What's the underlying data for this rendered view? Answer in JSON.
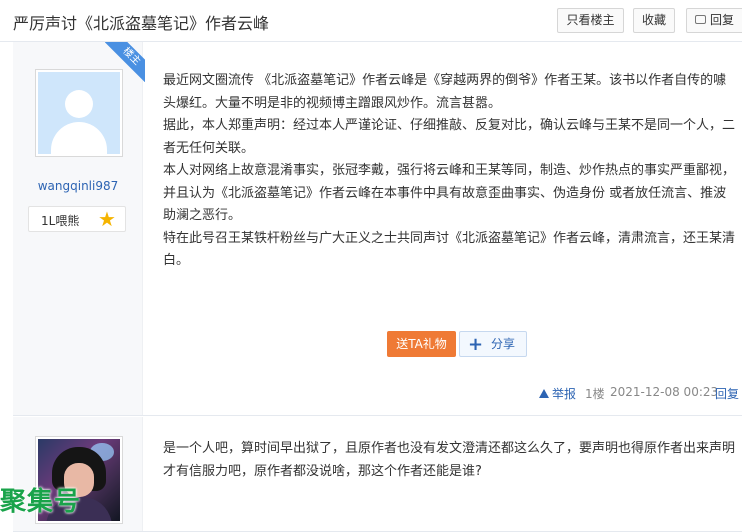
{
  "thread": {
    "title": "严厉声讨《北派盗墓笔记》作者云峰",
    "only_op_label": "只看楼主",
    "favorite_label": "收藏",
    "reply_label": "回复"
  },
  "posts": [
    {
      "username": "wangqinli987",
      "level_label": "1L喂熊",
      "op_badge": "楼主",
      "paragraphs": [
        "最近网文圈流传 《北派盗墓笔记》作者云峰是《穿越两界的倒爷》作者王某。该书以作者自传的噱头爆红。大量不明是非的视频博主蹭跟风炒作。流言甚嚣。",
        "据此，本人郑重声明：经过本人严谨论证、仔细推敲、反复对比，确认云峰与王某不是同一个人，二者无任何关联。",
        "本人对网络上故意混淆事实，张冠李戴，强行将云峰和王某等同，制造、炒作热点的事实严重鄙视，并且认为《北派盗墓笔记》作者云峰在本事件中具有故意歪曲事实、伪造身份 或者放任流言、推波助澜之恶行。",
        "特在此号召王某铁杆粉丝与广大正义之士共同声讨《北派盗墓笔记》作者云峰，清肃流言，还王某清白。"
      ],
      "gift_label": "送TA礼物",
      "share_label": "分享",
      "report_label": "举报",
      "floor": "1楼",
      "timestamp": "2021-12-08 00:23",
      "reply_label": "回复"
    },
    {
      "paragraphs": [
        "是一个人吧，算时间早出狱了，且原作者也没有发文澄清还都这么久了，要声明也得原作者出来声明才有信服力吧，原作者都没说啥，那这个作者还能是谁?"
      ]
    }
  ],
  "watermark": "聚集号",
  "colors": {
    "link_blue": "#2d64b3",
    "gift_orange": "#ef7a35",
    "op_badge_blue": "#4a90e2",
    "watermark_green": "#19a34a"
  },
  "icons": {
    "level": "star-icon",
    "share": "plus-icon",
    "report": "warning-icon",
    "reply": "comment-icon"
  }
}
